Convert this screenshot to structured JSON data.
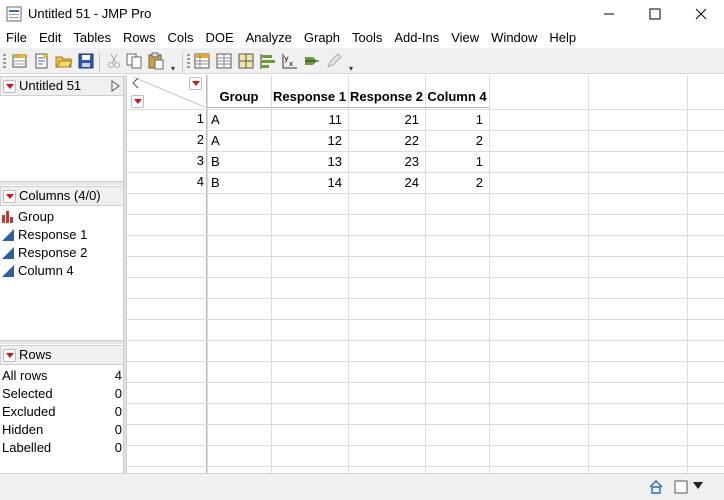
{
  "window": {
    "title": "Untitled 51 - JMP Pro"
  },
  "menu": [
    "File",
    "Edit",
    "Tables",
    "Rows",
    "Cols",
    "DOE",
    "Analyze",
    "Graph",
    "Tools",
    "Add-Ins",
    "View",
    "Window",
    "Help"
  ],
  "toolbar": {
    "icons": [
      "new-data-table-icon",
      "new-script-icon",
      "open-icon",
      "save-icon",
      "cut-icon",
      "copy-icon",
      "paste-icon",
      "data-table-icon",
      "table-list-icon",
      "tabulate-icon",
      "distribution-icon",
      "fit-model-icon",
      "graph-builder-icon",
      "edit-icon"
    ]
  },
  "table_panel": {
    "name": "Untitled 51"
  },
  "columns_panel": {
    "header": "Columns (4/0)",
    "items": [
      {
        "name": "Group",
        "icon": "nominal-icon"
      },
      {
        "name": "Response 1",
        "icon": "continuous-icon"
      },
      {
        "name": "Response 2",
        "icon": "continuous-icon"
      },
      {
        "name": "Column 4",
        "icon": "continuous-icon"
      }
    ]
  },
  "rows_panel": {
    "header": "Rows",
    "items": [
      {
        "label": "All rows",
        "value": "4"
      },
      {
        "label": "Selected",
        "value": "0"
      },
      {
        "label": "Excluded",
        "value": "0"
      },
      {
        "label": "Hidden",
        "value": "0"
      },
      {
        "label": "Labelled",
        "value": "0"
      }
    ]
  },
  "grid": {
    "headers": [
      "Group",
      "Response 1",
      "Response 2",
      "Column 4"
    ],
    "rows": [
      {
        "n": "1",
        "cells": [
          "A",
          "11",
          "21",
          "1"
        ]
      },
      {
        "n": "2",
        "cells": [
          "A",
          "12",
          "22",
          "2"
        ]
      },
      {
        "n": "3",
        "cells": [
          "B",
          "13",
          "23",
          "1"
        ]
      },
      {
        "n": "4",
        "cells": [
          "B",
          "14",
          "24",
          "2"
        ]
      }
    ]
  },
  "colors": {
    "accent_red": "#d4141c",
    "continuous_blue": "#2f5d9e",
    "nominal_red": "#c0392b"
  }
}
